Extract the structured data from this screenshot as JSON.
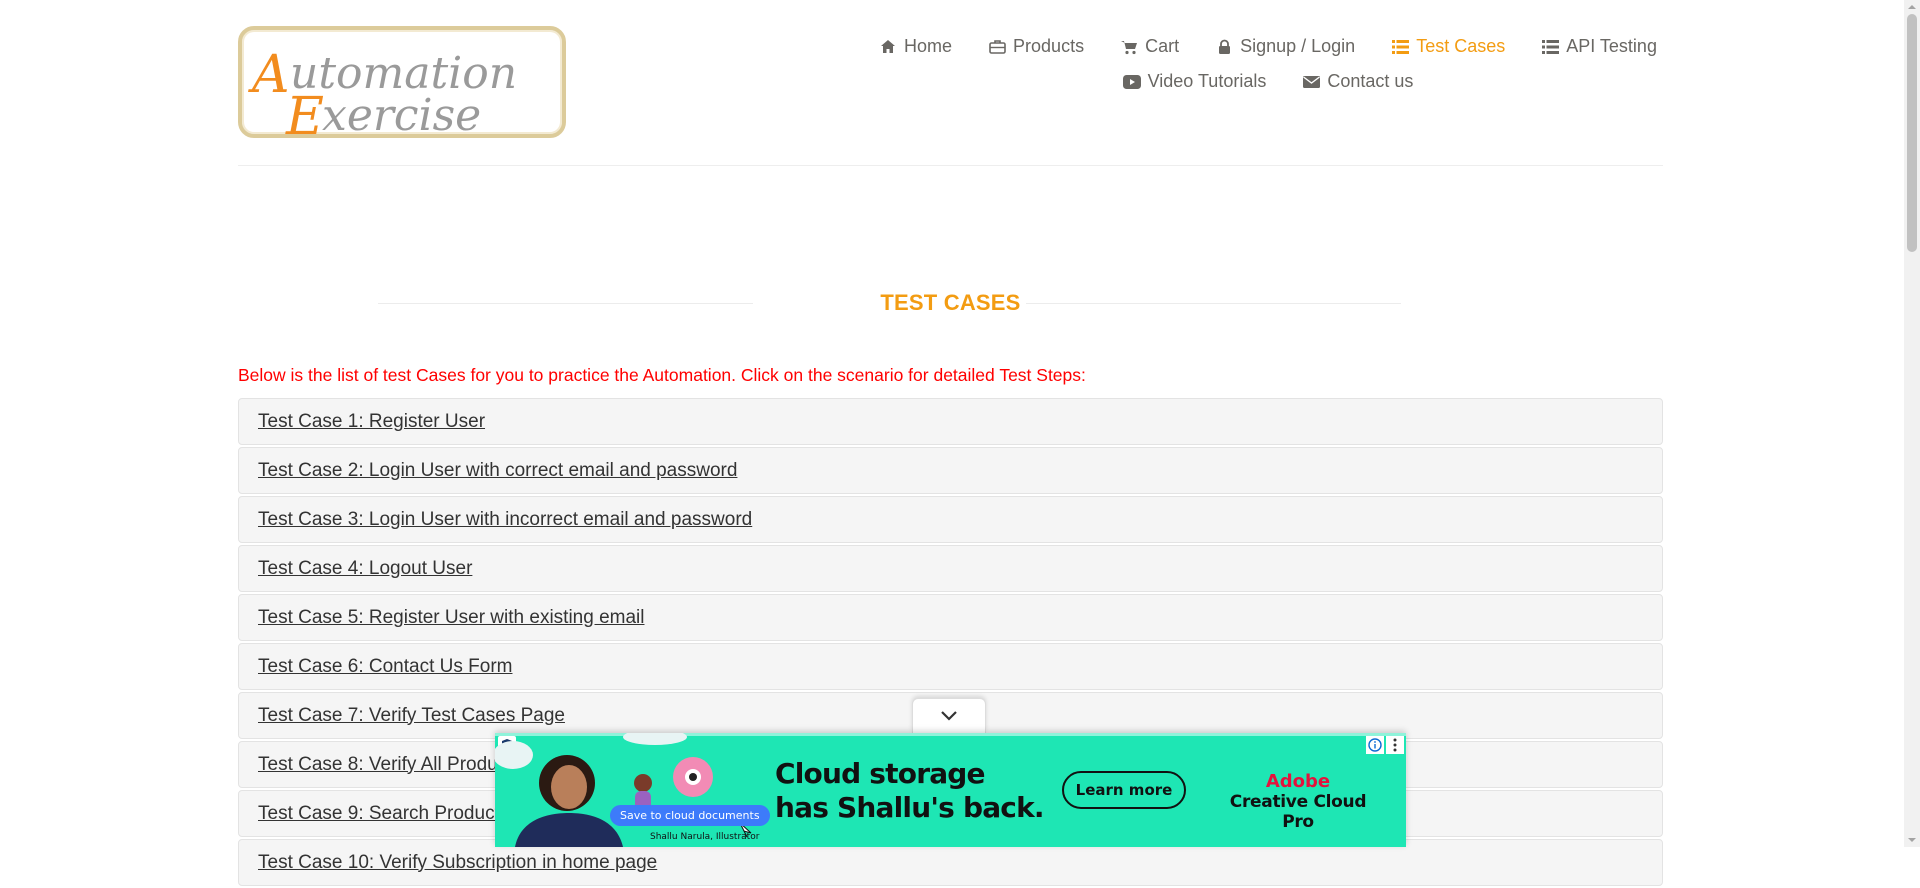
{
  "logo": {
    "alt": "Automation Exercise",
    "line1": "utomation",
    "line2": "xercise",
    "cap1": "A",
    "cap2": "E"
  },
  "nav": {
    "row1": [
      {
        "label": "Home",
        "icon": "home-icon"
      },
      {
        "label": "Products",
        "icon": "briefcase-icon"
      },
      {
        "label": "Cart",
        "icon": "cart-icon"
      },
      {
        "label": "Signup / Login",
        "icon": "lock-icon"
      },
      {
        "label": "Test Cases",
        "icon": "list-icon",
        "active": true
      },
      {
        "label": "API Testing",
        "icon": "list-icon"
      }
    ],
    "row2": [
      {
        "label": "Video Tutorials",
        "icon": "youtube-play-icon"
      },
      {
        "label": "Contact us",
        "icon": "envelope-icon"
      }
    ]
  },
  "page": {
    "title": "TEST CASES",
    "intro": "Below is the list of test Cases for you to practice the Automation. Click on the scenario for detailed Test Steps:"
  },
  "test_cases": [
    "Test Case 1: Register User",
    "Test Case 2: Login User with correct email and password",
    "Test Case 3: Login User with incorrect email and password",
    "Test Case 4: Logout User",
    "Test Case 5: Register User with existing email",
    "Test Case 6: Contact Us Form",
    "Test Case 7: Verify Test Cases Page",
    "Test Case 8: Verify All Products and product detail page",
    "Test Case 9: Search Product",
    "Test Case 10: Verify Subscription in home page"
  ],
  "ad": {
    "headline_1": "Cloud storage",
    "headline_2": "has Shallu's back.",
    "cta": "Learn more",
    "brand_1": "Adobe",
    "brand_2": "Creative Cloud Pro",
    "chip": "Save to cloud documents",
    "credit": "Shallu Narula, Illustrator"
  },
  "colors": {
    "accent": "#f39c12",
    "intro": "#ff0000",
    "ad_bg": "#1ee6b4"
  }
}
